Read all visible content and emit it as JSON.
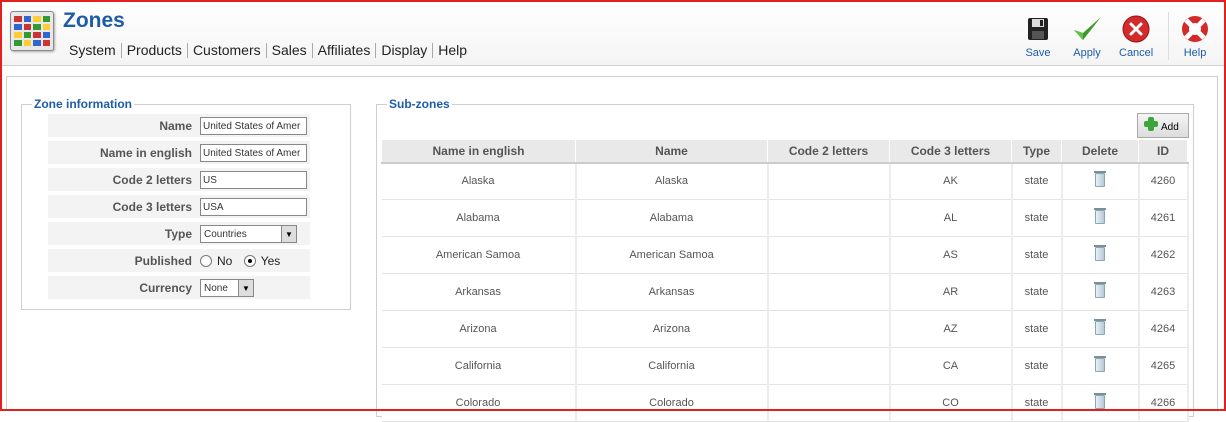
{
  "header": {
    "title": "Zones",
    "menu": [
      "System",
      "Products",
      "Customers",
      "Sales",
      "Affiliates",
      "Display",
      "Help"
    ],
    "toolbar": {
      "save": "Save",
      "apply": "Apply",
      "cancel": "Cancel",
      "help": "Help"
    }
  },
  "zone_info": {
    "legend": "Zone information",
    "fields": {
      "name": {
        "label": "Name",
        "value": "United States of Amer"
      },
      "name_english": {
        "label": "Name in english",
        "value": "United States of Amer"
      },
      "code2": {
        "label": "Code 2 letters",
        "value": "US"
      },
      "code3": {
        "label": "Code 3 letters",
        "value": "USA"
      },
      "type": {
        "label": "Type",
        "value": "Countries"
      },
      "published": {
        "label": "Published",
        "no": "No",
        "yes": "Yes",
        "selected": "Yes"
      },
      "currency": {
        "label": "Currency",
        "value": "None"
      }
    }
  },
  "subzones": {
    "legend": "Sub-zones",
    "add_label": "Add",
    "columns": [
      "Name in english",
      "Name",
      "Code 2 letters",
      "Code 3 letters",
      "Type",
      "Delete",
      "ID"
    ],
    "rows": [
      {
        "name_en": "Alaska",
        "name": "Alaska",
        "code2": "",
        "code3": "AK",
        "type": "state",
        "id": "4260"
      },
      {
        "name_en": "Alabama",
        "name": "Alabama",
        "code2": "",
        "code3": "AL",
        "type": "state",
        "id": "4261"
      },
      {
        "name_en": "American Samoa",
        "name": "American Samoa",
        "code2": "",
        "code3": "AS",
        "type": "state",
        "id": "4262"
      },
      {
        "name_en": "Arkansas",
        "name": "Arkansas",
        "code2": "",
        "code3": "AR",
        "type": "state",
        "id": "4263"
      },
      {
        "name_en": "Arizona",
        "name": "Arizona",
        "code2": "",
        "code3": "AZ",
        "type": "state",
        "id": "4264"
      },
      {
        "name_en": "California",
        "name": "California",
        "code2": "",
        "code3": "CA",
        "type": "state",
        "id": "4265"
      },
      {
        "name_en": "Colorado",
        "name": "Colorado",
        "code2": "",
        "code3": "CO",
        "type": "state",
        "id": "4266"
      }
    ]
  },
  "colors": {
    "accent": "#1f5ca8",
    "frame": "#e41f1f"
  }
}
